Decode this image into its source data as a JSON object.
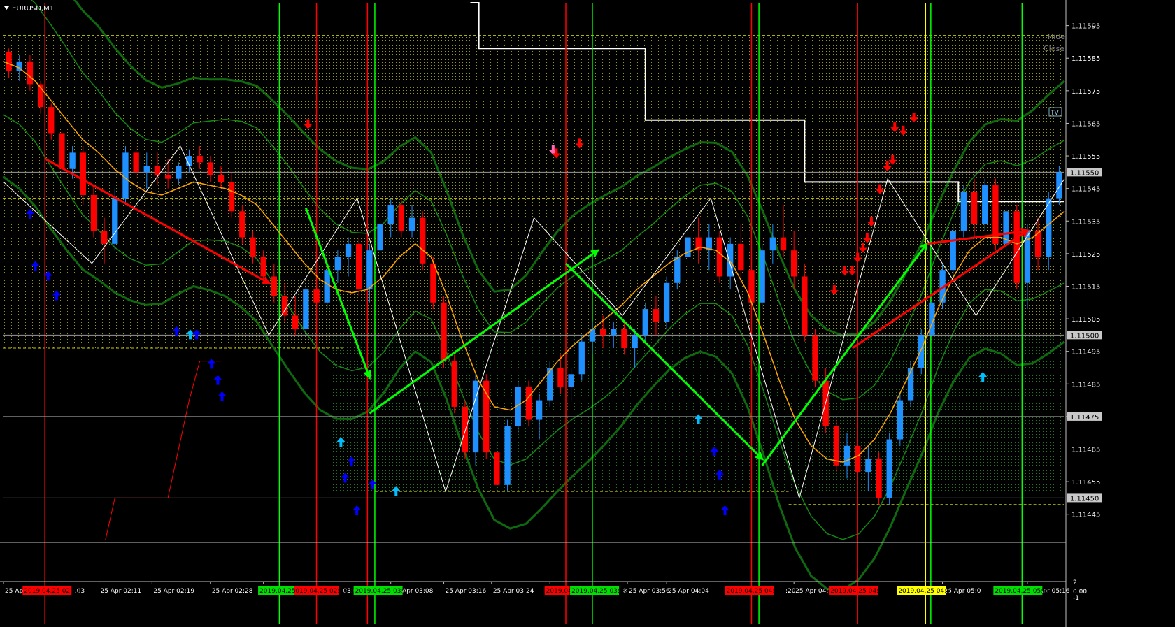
{
  "window": {
    "title": "EURUSD,M1"
  },
  "controls": {
    "hide": "Hide",
    "close": "Close",
    "tv": "TV"
  },
  "colors": {
    "background": "#000000",
    "bull": "#1e90ff",
    "bear": "#ff0000",
    "ma_orange": "#ffa500",
    "band_green": "#107010",
    "signal_green": "#00ff00",
    "signal_red": "#ff0000",
    "signal_yellow": "#ffff00",
    "zone_yellow": "#c8c800",
    "zigzag": "#ffffff",
    "arrow_up_blue": "#0000ff",
    "arrow_up_cyan": "#00bfff",
    "arrow_down_red": "#ff0000"
  },
  "chart_data": {
    "type": "candlestick",
    "symbol": "EURUSD",
    "timeframe": "M1",
    "ylim": [
      1.11437,
      1.11602
    ],
    "y_ticks": [
      "1.11595",
      "1.11585",
      "1.11575",
      "1.11565",
      "1.11555",
      "1.11545",
      "1.11535",
      "1.11525",
      "1.11515",
      "1.11505",
      "1.11495",
      "1.11485",
      "1.11475",
      "1.11465",
      "1.11455",
      "1.11445"
    ],
    "price_markers": [
      {
        "label": "1.11550",
        "value": 1.1155
      },
      {
        "label": "1.11500",
        "value": 1.115
      },
      {
        "label": "1.11475",
        "value": 1.11475
      },
      {
        "label": "1.11450",
        "value": 1.1145
      }
    ],
    "x_ticks": [
      "25 Apr",
      "25 Apr 02:11",
      "25 Apr 02:19",
      "25 Apr 02:28",
      "25 Apr 02:36",
      "25 Apr 03:08",
      "25 Apr 03:16",
      "25 Apr 03:24",
      "25 Apr 03:32",
      "25 Apr 03:56",
      "25 Apr 04:04",
      "25 Apr 04:2",
      "25 Apr 05:0",
      "25 Apr 05:16"
    ],
    "time_flags": [
      {
        "label": "2019.04.25 02:03",
        "color": "red"
      },
      {
        "label": "2019.04.25 02:56",
        "color": "red"
      },
      {
        "label": "2019.04.25",
        "color": "green"
      },
      {
        "label": "2019.04.25 03:07",
        "color": "green"
      },
      {
        "label": "2019.04",
        "color": "red"
      },
      {
        "label": "2019.04.25 03:49",
        "color": "green"
      },
      {
        "label": "2019.04.25 04:19",
        "color": "red"
      },
      {
        "label": "2019.04.25 04:39",
        "color": "red"
      },
      {
        "label": "2019.04.25 04:52",
        "color": "yellow"
      },
      {
        "label": "2019.04.25 05:11",
        "color": "green"
      }
    ],
    "x_tick_fragments": [
      ":03",
      "03:08",
      "8",
      ":20"
    ],
    "sub_axis_ticks": [
      "2",
      "0.00",
      "-1"
    ],
    "candles": [
      [
        1.11587,
        1.11588,
        1.11579,
        1.11581
      ],
      [
        1.11581,
        1.11586,
        1.11578,
        1.11584
      ],
      [
        1.11584,
        1.11586,
        1.11575,
        1.11577
      ],
      [
        1.11577,
        1.11578,
        1.11568,
        1.1157
      ],
      [
        1.1157,
        1.11571,
        1.1156,
        1.11562
      ],
      [
        1.11562,
        1.11563,
        1.11548,
        1.11551
      ],
      [
        1.11551,
        1.11558,
        1.11548,
        1.11556
      ],
      [
        1.11556,
        1.11558,
        1.1154,
        1.11543
      ],
      [
        1.11543,
        1.11546,
        1.1153,
        1.11532
      ],
      [
        1.11532,
        1.11536,
        1.11522,
        1.11528
      ],
      [
        1.11528,
        1.11545,
        1.11526,
        1.11542
      ],
      [
        1.11542,
        1.11558,
        1.1154,
        1.11556
      ],
      [
        1.11556,
        1.11558,
        1.11548,
        1.1155
      ],
      [
        1.1155,
        1.11556,
        1.11545,
        1.11552
      ],
      [
        1.11552,
        1.11556,
        1.11546,
        1.11549
      ],
      [
        1.11549,
        1.11554,
        1.11545,
        1.11548
      ],
      [
        1.11548,
        1.11553,
        1.11546,
        1.11552
      ],
      [
        1.11552,
        1.11557,
        1.1155,
        1.11555
      ],
      [
        1.11555,
        1.11558,
        1.11551,
        1.11553
      ],
      [
        1.11553,
        1.11555,
        1.11547,
        1.11549
      ],
      [
        1.11549,
        1.11552,
        1.11545,
        1.11547
      ],
      [
        1.11547,
        1.1155,
        1.11536,
        1.11538
      ],
      [
        1.11538,
        1.1154,
        1.11528,
        1.1153
      ],
      [
        1.1153,
        1.11532,
        1.11522,
        1.11524
      ],
      [
        1.11524,
        1.11526,
        1.11516,
        1.11518
      ],
      [
        1.11518,
        1.11522,
        1.1151,
        1.11512
      ],
      [
        1.11512,
        1.11516,
        1.11504,
        1.11506
      ],
      [
        1.11506,
        1.11512,
        1.115,
        1.11502
      ],
      [
        1.11502,
        1.11516,
        1.115,
        1.11514
      ],
      [
        1.11514,
        1.11518,
        1.11508,
        1.1151
      ],
      [
        1.1151,
        1.11522,
        1.11508,
        1.1152
      ],
      [
        1.1152,
        1.11526,
        1.11516,
        1.11524
      ],
      [
        1.11524,
        1.1153,
        1.11518,
        1.11528
      ],
      [
        1.11528,
        1.1153,
        1.11512,
        1.11514
      ],
      [
        1.11514,
        1.11528,
        1.1151,
        1.11526
      ],
      [
        1.11526,
        1.11536,
        1.11524,
        1.11534
      ],
      [
        1.11534,
        1.11542,
        1.1153,
        1.1154
      ],
      [
        1.1154,
        1.11542,
        1.1153,
        1.11532
      ],
      [
        1.11532,
        1.1154,
        1.1153,
        1.11536
      ],
      [
        1.11536,
        1.11538,
        1.1152,
        1.11522
      ],
      [
        1.11522,
        1.11524,
        1.11508,
        1.1151
      ],
      [
        1.1151,
        1.11512,
        1.1149,
        1.11492
      ],
      [
        1.11492,
        1.11494,
        1.11476,
        1.11478
      ],
      [
        1.11478,
        1.1148,
        1.11462,
        1.11464
      ],
      [
        1.11464,
        1.11488,
        1.1146,
        1.11486
      ],
      [
        1.11486,
        1.11488,
        1.11462,
        1.11464
      ],
      [
        1.11464,
        1.11466,
        1.11452,
        1.11454
      ],
      [
        1.11454,
        1.11474,
        1.11452,
        1.11472
      ],
      [
        1.11472,
        1.11486,
        1.1147,
        1.11484
      ],
      [
        1.11484,
        1.11486,
        1.11472,
        1.11474
      ],
      [
        1.11474,
        1.11482,
        1.11468,
        1.1148
      ],
      [
        1.1148,
        1.11492,
        1.11478,
        1.1149
      ],
      [
        1.1149,
        1.11494,
        1.11482,
        1.11484
      ],
      [
        1.11484,
        1.1149,
        1.1148,
        1.11488
      ],
      [
        1.11488,
        1.115,
        1.11486,
        1.11498
      ],
      [
        1.11498,
        1.11504,
        1.11494,
        1.11502
      ],
      [
        1.11502,
        1.11506,
        1.11496,
        1.115
      ],
      [
        1.115,
        1.11504,
        1.11496,
        1.11502
      ],
      [
        1.11502,
        1.11504,
        1.11494,
        1.11496
      ],
      [
        1.11496,
        1.11502,
        1.1149,
        1.115
      ],
      [
        1.115,
        1.1151,
        1.11498,
        1.11508
      ],
      [
        1.11508,
        1.11512,
        1.115,
        1.11504
      ],
      [
        1.11504,
        1.11518,
        1.11502,
        1.11516
      ],
      [
        1.11516,
        1.11526,
        1.11514,
        1.11524
      ],
      [
        1.11524,
        1.11532,
        1.1152,
        1.1153
      ],
      [
        1.1153,
        1.11536,
        1.11522,
        1.11526
      ],
      [
        1.11526,
        1.11534,
        1.1152,
        1.1153
      ],
      [
        1.1153,
        1.11532,
        1.11516,
        1.11518
      ],
      [
        1.11518,
        1.1153,
        1.11514,
        1.11528
      ],
      [
        1.11528,
        1.11534,
        1.11516,
        1.1152
      ],
      [
        1.1152,
        1.11524,
        1.11506,
        1.1151
      ],
      [
        1.1151,
        1.11528,
        1.11508,
        1.11526
      ],
      [
        1.11526,
        1.11534,
        1.11522,
        1.1153
      ],
      [
        1.1153,
        1.1154,
        1.11524,
        1.11526
      ],
      [
        1.11526,
        1.11532,
        1.11514,
        1.11518
      ],
      [
        1.11518,
        1.11522,
        1.11498,
        1.115
      ],
      [
        1.115,
        1.11502,
        1.11484,
        1.11486
      ],
      [
        1.11486,
        1.1149,
        1.1147,
        1.11472
      ],
      [
        1.11472,
        1.11474,
        1.11458,
        1.1146
      ],
      [
        1.1146,
        1.1147,
        1.11456,
        1.11466
      ],
      [
        1.11466,
        1.11468,
        1.11456,
        1.11458
      ],
      [
        1.11458,
        1.11466,
        1.11452,
        1.11462
      ],
      [
        1.11462,
        1.11464,
        1.11448,
        1.1145
      ],
      [
        1.1145,
        1.1147,
        1.11448,
        1.11468
      ],
      [
        1.11468,
        1.11482,
        1.11466,
        1.1148
      ],
      [
        1.1148,
        1.11492,
        1.11478,
        1.1149
      ],
      [
        1.1149,
        1.11502,
        1.11488,
        1.115
      ],
      [
        1.115,
        1.11512,
        1.11498,
        1.1151
      ],
      [
        1.1151,
        1.11522,
        1.11508,
        1.1152
      ],
      [
        1.1152,
        1.11534,
        1.11518,
        1.11532
      ],
      [
        1.11532,
        1.11546,
        1.1153,
        1.11544
      ],
      [
        1.11544,
        1.11548,
        1.1153,
        1.11534
      ],
      [
        1.11534,
        1.11548,
        1.11532,
        1.11546
      ],
      [
        1.11546,
        1.11548,
        1.11526,
        1.11528
      ],
      [
        1.11528,
        1.1154,
        1.11524,
        1.11538
      ],
      [
        1.11538,
        1.1154,
        1.11514,
        1.11516
      ],
      [
        1.11516,
        1.11534,
        1.11508,
        1.11532
      ],
      [
        1.11532,
        1.11536,
        1.1152,
        1.11524
      ],
      [
        1.11524,
        1.11544,
        1.1152,
        1.11542
      ],
      [
        1.11542,
        1.11552,
        1.1154,
        1.1155
      ]
    ],
    "moving_average": [
      1.11584,
      1.11582,
      1.11578,
      1.11572,
      1.11566,
      1.1156,
      1.11556,
      1.11551,
      1.11547,
      1.11544,
      1.11543,
      1.11545,
      1.11547,
      1.11546,
      1.11545,
      1.11543,
      1.1154,
      1.11534,
      1.11528,
      1.11522,
      1.11517,
      1.11514,
      1.11513,
      1.11514,
      1.11518,
      1.11524,
      1.11528,
      1.11524,
      1.11512,
      1.11498,
      1.11486,
      1.11478,
      1.11477,
      1.1148,
      1.11486,
      1.11492,
      1.11497,
      1.11501,
      1.11505,
      1.11509,
      1.11514,
      1.11518,
      1.11522,
      1.11525,
      1.11527,
      1.11526,
      1.11522,
      1.11513,
      1.115,
      1.11486,
      1.11474,
      1.11466,
      1.11462,
      1.11461,
      1.11463,
      1.11468,
      1.11476,
      1.11486,
      1.11496,
      1.11508,
      1.11518,
      1.11526,
      1.1153,
      1.1153,
      1.11528,
      1.1153,
      1.11534,
      1.11538
    ],
    "zigzag": [
      1.11547,
      1.11522,
      1.11558,
      1.115,
      1.11542,
      1.11452,
      1.11536,
      1.11506,
      1.11542,
      1.1145,
      1.11548,
      1.11506,
      1.11548
    ],
    "trend_arrows": [
      {
        "from": [
          1.11554,
          0.04
        ],
        "to": [
          1.11516,
          0.25
        ],
        "color": "red"
      },
      {
        "from": [
          1.11539,
          0.285
        ],
        "to": [
          1.11487,
          0.345
        ],
        "color": "green"
      },
      {
        "from": [
          1.11476,
          0.345
        ],
        "to": [
          1.11526,
          0.56
        ],
        "color": "green"
      },
      {
        "from": [
          1.11522,
          0.53
        ],
        "to": [
          1.11462,
          0.715
        ],
        "color": "green"
      },
      {
        "from": [
          1.1146,
          0.715
        ],
        "to": [
          1.11528,
          0.87
        ],
        "color": "green"
      },
      {
        "from": [
          1.11496,
          0.8
        ],
        "to": [
          1.11532,
          0.965
        ],
        "color": "red"
      },
      {
        "from": [
          1.11528,
          0.87
        ],
        "to": [
          1.11532,
          0.965
        ],
        "color": "red"
      }
    ]
  }
}
